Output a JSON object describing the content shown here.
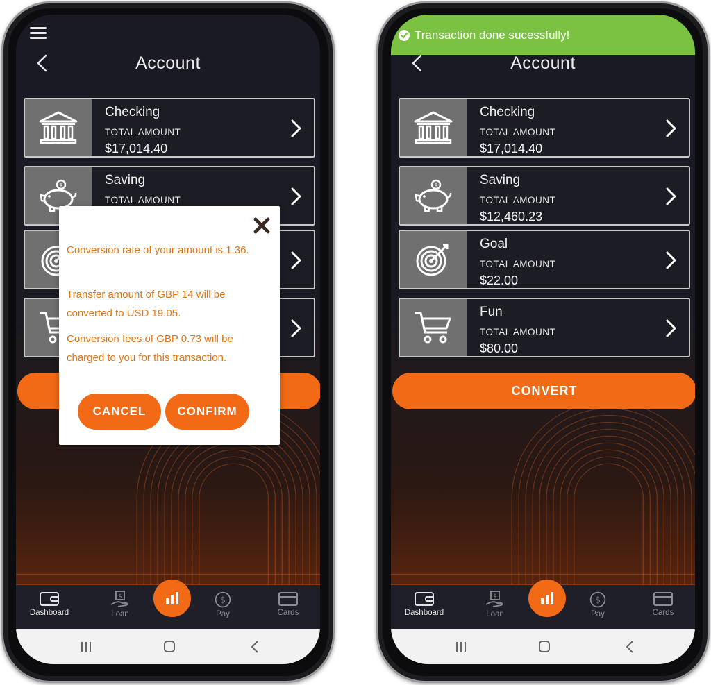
{
  "colors": {
    "accent": "#f26a16",
    "success": "#7bc142",
    "background": "#1a1a24",
    "modal_text": "#e07514"
  },
  "left_phone": {
    "header": {
      "title": "Account"
    },
    "accounts": [
      {
        "name": "Checking",
        "label": "TOTAL AMOUNT",
        "amount": "$17,014.40",
        "icon": "bank-icon"
      },
      {
        "name": "Saving",
        "label": "TOTAL AMOUNT",
        "amount": "",
        "icon": "piggy-bank-icon"
      },
      {
        "name": "",
        "label": "",
        "amount": "",
        "icon": "target-icon"
      },
      {
        "name": "",
        "label": "",
        "amount": "",
        "icon": "cart-icon"
      }
    ],
    "modal": {
      "line1": "Conversion rate of your amount is 1.36.",
      "line2": "Transfer amount of GBP 14 will be converted to USD 19.05.",
      "line3": "Conversion fees of GBP 0.73 will be charged to you for this transaction.",
      "cancel_label": "CANCEL",
      "confirm_label": "CONFIRM"
    },
    "nav": [
      "Dashboard",
      "Loan",
      "Pay",
      "Cards"
    ]
  },
  "right_phone": {
    "toast": "Transaction done sucessfully!",
    "header": {
      "title": "Account"
    },
    "accounts": [
      {
        "name": "Checking",
        "label": "TOTAL AMOUNT",
        "amount": "$17,014.40",
        "icon": "bank-icon"
      },
      {
        "name": "Saving",
        "label": "TOTAL AMOUNT",
        "amount": "$12,460.23",
        "icon": "piggy-bank-icon"
      },
      {
        "name": "Goal",
        "label": "TOTAL AMOUNT",
        "amount": "$22.00",
        "icon": "target-icon"
      },
      {
        "name": "Fun",
        "label": "TOTAL AMOUNT",
        "amount": "$80.00",
        "icon": "cart-icon"
      }
    ],
    "convert_label": "CONVERT",
    "nav": [
      "Dashboard",
      "Loan",
      "Pay",
      "Cards"
    ]
  }
}
